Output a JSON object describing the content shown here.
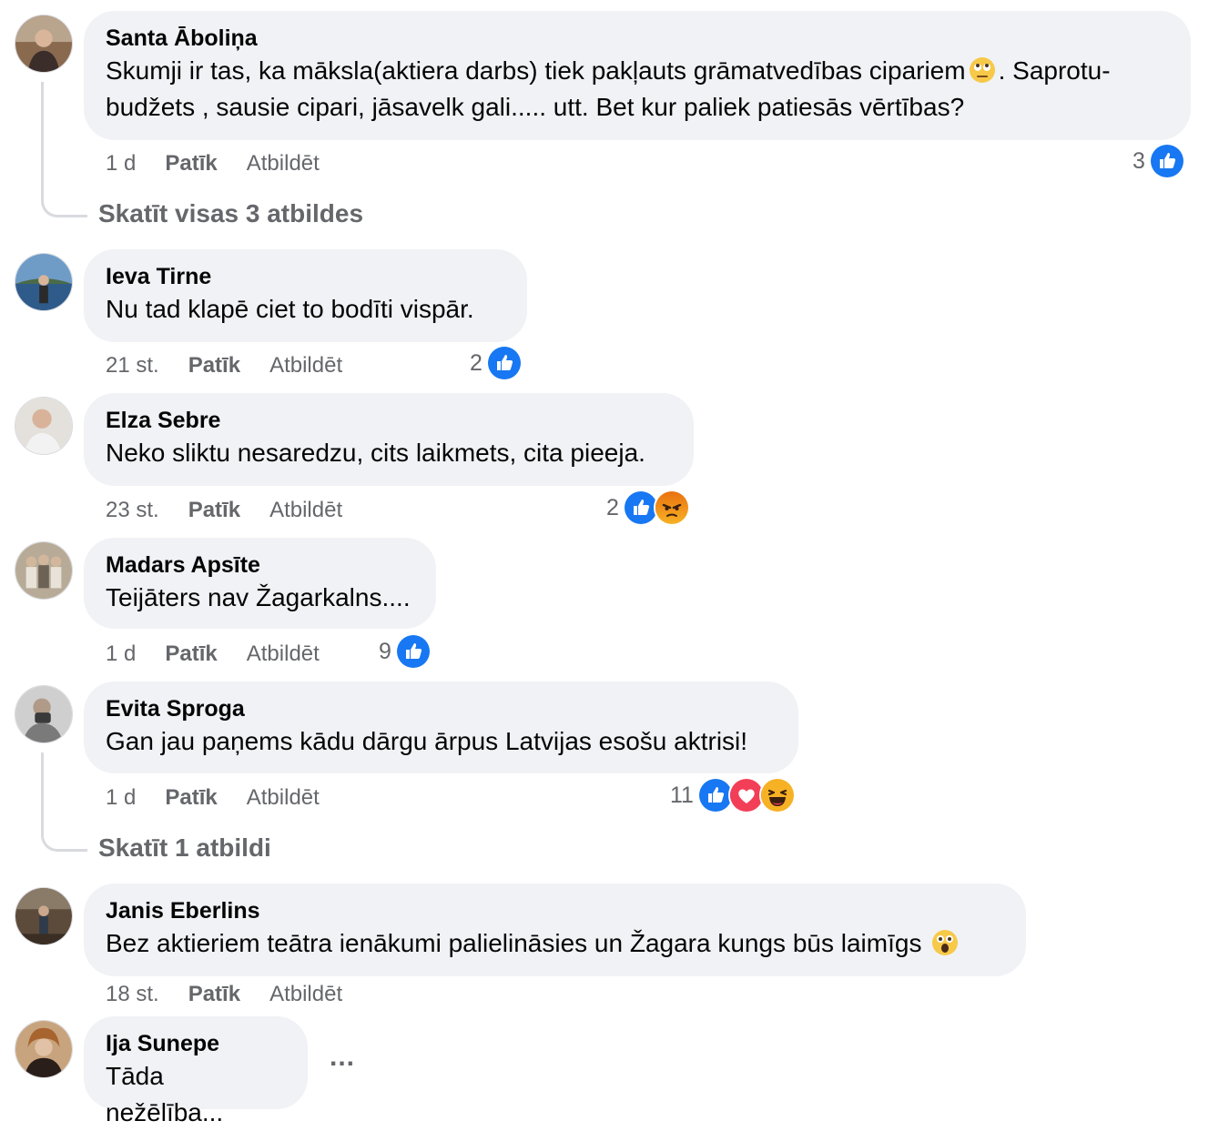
{
  "comments": [
    {
      "author": "Santa Āboliņa",
      "text_before_emoji": "Skumji ir tas, ka māksla(aktiera darbs) tiek pakļauts grāmatvedības cipariem",
      "emoji": "face-with-rolling-eyes",
      "text_after_emoji": ". Saprotu- budžets , sausie cipari, jāsavelk gali..... utt. Bet kur paliek patiesās vērtības?",
      "time": "1 d",
      "like_label": "Patīk",
      "reply_label": "Atbildēt",
      "reaction_count": "3",
      "reactions": [
        "like"
      ],
      "view_replies": "Skatīt visas 3 atbildes"
    },
    {
      "author": "Ieva Tirne",
      "text": "Nu tad klapē ciet to bodīti vispār.",
      "time": "21 st.",
      "like_label": "Patīk",
      "reply_label": "Atbildēt",
      "reaction_count": "2",
      "reactions": [
        "like"
      ]
    },
    {
      "author": "Elza Sebre",
      "text": "Neko sliktu nesaredzu, cits laikmets, cita pieeja.",
      "time": "23 st.",
      "like_label": "Patīk",
      "reply_label": "Atbildēt",
      "reaction_count": "2",
      "reactions": [
        "like",
        "angry"
      ]
    },
    {
      "author": "Madars Apsīte",
      "text": "Teijāters nav Žagarkalns....",
      "time": "1 d",
      "like_label": "Patīk",
      "reply_label": "Atbildēt",
      "reaction_count": "9",
      "reactions": [
        "like"
      ]
    },
    {
      "author": "Evita Sproga",
      "text": "Gan jau paņems kādu dārgu ārpus Latvijas esošu aktrisi!",
      "time": "1 d",
      "like_label": "Patīk",
      "reply_label": "Atbildēt",
      "reaction_count": "11",
      "reactions": [
        "like",
        "love",
        "haha"
      ],
      "view_replies": "Skatīt 1 atbildi"
    },
    {
      "author": "Janis Eberlins",
      "text": "Bez aktieriem teātra ienākumi palielināsies un Žagara kungs būs laimīgs",
      "emoji": "astonished-face",
      "time": "18 st.",
      "like_label": "Patīk",
      "reply_label": "Atbildēt"
    },
    {
      "author": "Ija Sunepe",
      "text": "Tāda nežēlība...",
      "more_label": "..."
    }
  ],
  "colors": {
    "like_blue": "#1877f2",
    "love_red": "#f33e58",
    "angry_orange": "#e9710f",
    "haha_yellow": "#f7b125",
    "bubble": "#f0f2f5",
    "meta_gray": "#65676b"
  }
}
